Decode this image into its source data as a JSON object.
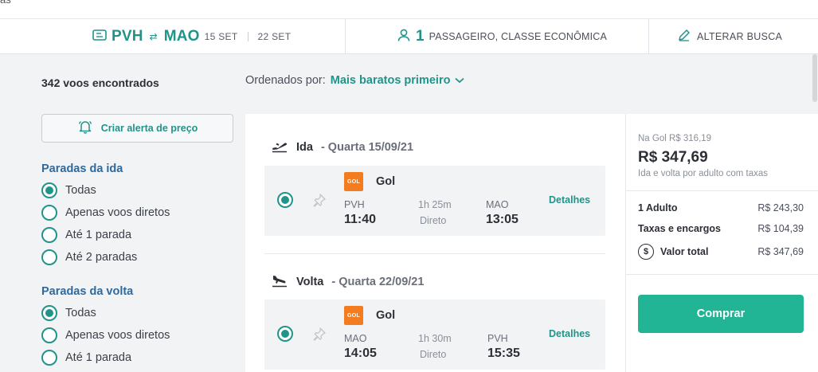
{
  "topstrip": {
    "cut_text": "as"
  },
  "search": {
    "origin": "PVH",
    "swap_icon": "⇄",
    "destination": "MAO",
    "date_out": "15 SET",
    "date_back": "22 SET",
    "pax_count": "1",
    "pax_text": "PASSAGEIRO, CLASSE ECONÔMICA",
    "edit_label": "ALTERAR BUSCA"
  },
  "results": {
    "count": "342 voos encontrados",
    "sort_label": "Ordenados por:",
    "sort_value": "Mais baratos primeiro"
  },
  "alert": {
    "label": "Criar alerta de preço"
  },
  "filters": {
    "outbound": {
      "title": "Paradas da ida",
      "options": [
        {
          "label": "Todas",
          "selected": true
        },
        {
          "label": "Apenas voos diretos",
          "selected": false
        },
        {
          "label": "Até 1 parada",
          "selected": false
        },
        {
          "label": "Até 2 paradas",
          "selected": false
        }
      ]
    },
    "return": {
      "title": "Paradas da volta",
      "options": [
        {
          "label": "Todas",
          "selected": true
        },
        {
          "label": "Apenas voos diretos",
          "selected": false
        },
        {
          "label": "Até 1 parada",
          "selected": false
        }
      ]
    }
  },
  "legs": [
    {
      "direction": "Ida",
      "date": "- Quarta 15/09/21",
      "airline": "Gol",
      "logo_text": "GOL",
      "from": "PVH",
      "dep_time": "11:40",
      "duration": "1h 25m",
      "stops": "Direto",
      "to": "MAO",
      "arr_time": "13:05",
      "details": "Detalhes"
    },
    {
      "direction": "Volta",
      "date": "- Quarta 22/09/21",
      "airline": "Gol",
      "logo_text": "GOL",
      "from": "MAO",
      "dep_time": "14:05",
      "duration": "1h 30m",
      "stops": "Direto",
      "to": "PVH",
      "arr_time": "15:35",
      "details": "Detalhes"
    }
  ],
  "price": {
    "hint": "Na Gol R$ 316,19",
    "total": "R$ 347,69",
    "sub": "Ida e volta por adulto com taxas",
    "rows": [
      {
        "label": "1 Adulto",
        "value": "R$ 243,30"
      },
      {
        "label": "Taxas e encargos",
        "value": "R$ 104,39"
      },
      {
        "label": "Valor total",
        "value": "R$ 347,69"
      }
    ],
    "buy_label": "Comprar"
  },
  "colors": {
    "accent": "#21948a",
    "button": "#21b596",
    "filter_title": "#2c6aa0",
    "gol_orange": "#f47c20"
  }
}
